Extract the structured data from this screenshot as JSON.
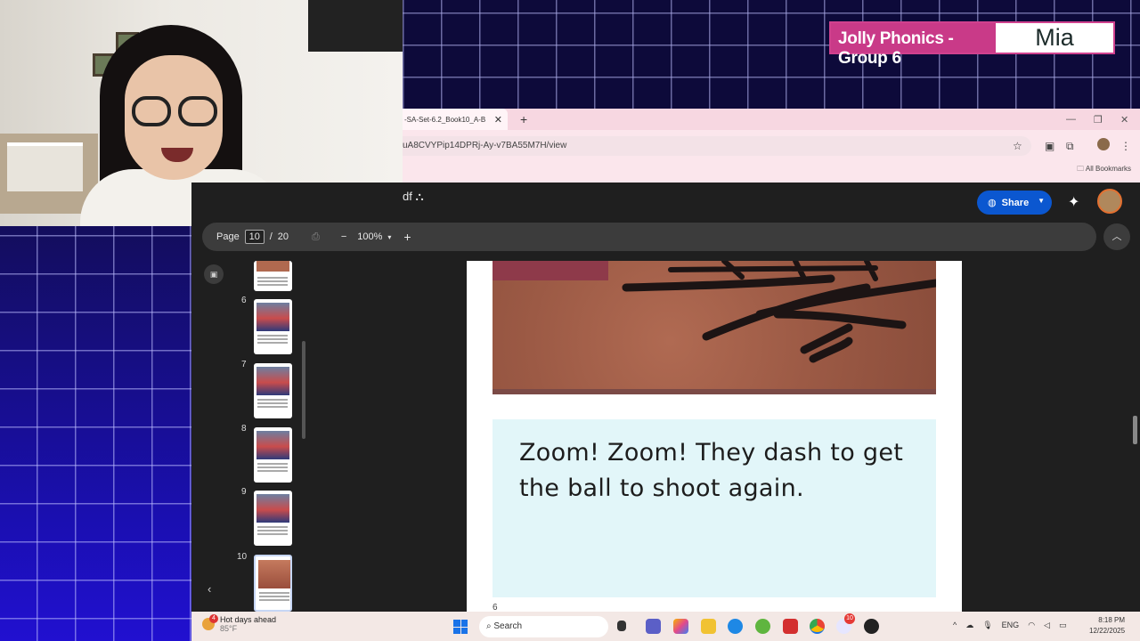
{
  "overlay": {
    "group_label": "Jolly Phonics - Group 6",
    "name_label": "Mia"
  },
  "browser": {
    "tab_title": "-SA-Set-6.2_Book10_A-B",
    "url": "uA8CVYPip14DPRj-Ay-v7BA55M7H/view",
    "bookmarks_label": "All Bookmarks"
  },
  "drive": {
    "file_suffix": "df",
    "share_label": "Share",
    "toolbar": {
      "page_label": "Page",
      "current_page": "10",
      "separator": "/",
      "total_pages": "20",
      "zoom": "100%"
    },
    "thumbnails": [
      {
        "number": "6"
      },
      {
        "number": "7"
      },
      {
        "number": "8"
      },
      {
        "number": "9"
      },
      {
        "number": "10"
      }
    ],
    "page": {
      "text_line1": "Zoom! Zoom! They dash to get",
      "text_line2": "the ball to shoot again.",
      "page_number": "6"
    }
  },
  "taskbar": {
    "weather_title": "Hot days ahead",
    "weather_temp": "85°F",
    "weather_badge": "4",
    "search_placeholder": "Search",
    "language": "ENG",
    "time": "8:18 PM",
    "date": "12/22/2025",
    "app_badge": "10"
  },
  "colors": {
    "badge_pink": "#c93a88",
    "share_blue": "#0b57d0",
    "text_panel": "#e2f6f9"
  }
}
